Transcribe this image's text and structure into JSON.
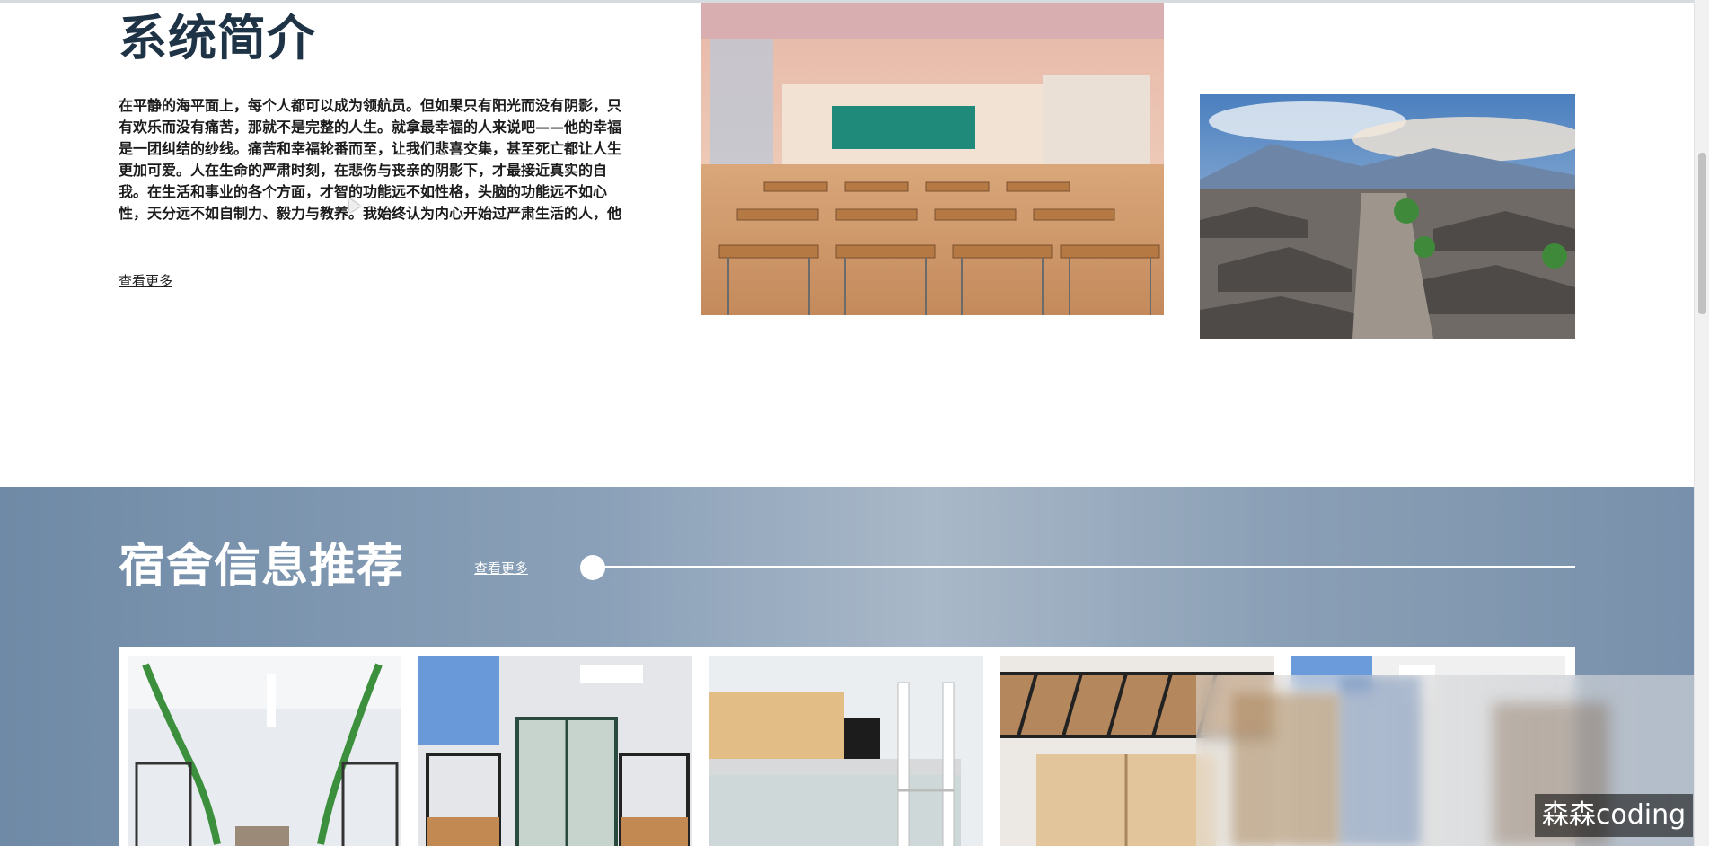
{
  "intro": {
    "title": "系统简介",
    "body": "在平静的海平面上，每个人都可以成为领航员。但如果只有阳光而没有阴影，只有欢乐而没有痛苦，那就不是完整的人生。就拿最幸福的人来说吧——他的幸福是一团纠结的纱线。痛苦和幸福轮番而至，让我们悲喜交集，甚至死亡都让人生更加可爱。人在生命的严肃时刻，在悲伤与丧亲的阴影下，才最接近真实的自我。在生活和事业的各个方面，才智的功能远不如性格，头脑的功能远不如心性，天分远不如自制力、毅力与教养。我始终认为内心开始过严肃生活的人，他",
    "more_label": "查看更多"
  },
  "recommend": {
    "title": "宿舍信息推荐",
    "more_label": "查看更多"
  },
  "watermark": "森森coding",
  "colors": {
    "title": "#1f3346",
    "recommend_bg": "#8aa0b8",
    "white": "#ffffff"
  }
}
